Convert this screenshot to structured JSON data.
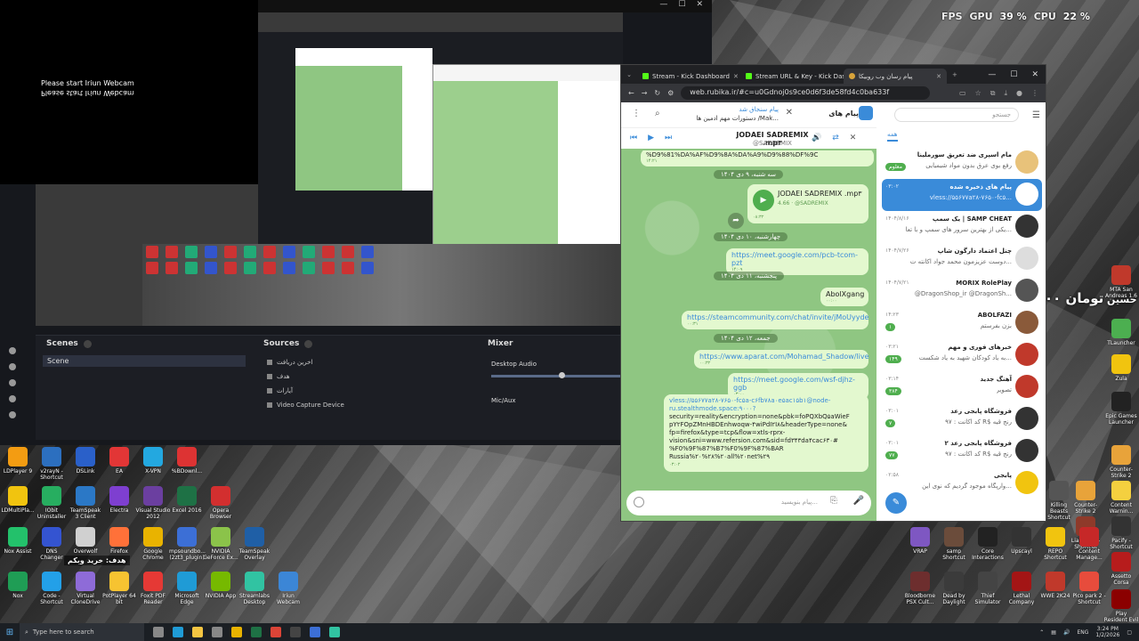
{
  "stats": {
    "fps_label": "FPS",
    "gpu_label": "GPU",
    "gpu_value": "39 %",
    "cpu_label": "CPU",
    "cpu_value": "22 %"
  },
  "webcam": {
    "message": "Please start Iriun Webcam",
    "message_mirror": "Please start Iriun Webcam"
  },
  "obs": {
    "scenes_title": "Scenes",
    "scene_name": "Scene",
    "sources_title": "Sources",
    "sources": [
      "اخرین دریافت",
      "هدف",
      "آیارات",
      "Video Capture Device"
    ],
    "mixer_title": "Mixer",
    "mixer_tracks": [
      "Desktop Audio",
      "Mic/Aux"
    ]
  },
  "desktop_icons_left": [
    {
      "label": "LDPlayer 9",
      "color": "#f39c12"
    },
    {
      "label": "v2rayN - Shortcut",
      "color": "#2c6fbf"
    },
    {
      "label": "DSLink",
      "color": "#2a60c9"
    },
    {
      "label": "EA",
      "color": "#e23636"
    },
    {
      "label": "X-VPN",
      "color": "#23a8e0"
    },
    {
      "label": "%BDownl...",
      "color": "#d33"
    },
    {
      "label": "LDMultiPla...",
      "color": "#f1c40f"
    },
    {
      "label": "IObit Uninstaller",
      "color": "#27ae60"
    },
    {
      "label": "TeamSpeak 3 Client",
      "color": "#2b78c6"
    },
    {
      "label": "Electra",
      "color": "#7e3fd0"
    },
    {
      "label": "Visual Studio 2012",
      "color": "#6b3fa0"
    },
    {
      "label": "Excel 2016",
      "color": "#1e7145"
    },
    {
      "label": "Opera Browser",
      "color": "#d32f2f"
    },
    {
      "label": "Nox Assist",
      "color": "#23c16b"
    },
    {
      "label": "DNS Changer",
      "color": "#3454d1"
    },
    {
      "label": "Overwolf",
      "color": "#d0d0d0"
    },
    {
      "label": "Firefox",
      "color": "#ff7139"
    },
    {
      "label": "Google Chrome",
      "color": "#e9b300"
    },
    {
      "label": "mpsoundbo... (2zt3_plugin)",
      "color": "#3c6fd6"
    },
    {
      "label": "NVIDIA GeForce Ex...",
      "color": "#8bc34a"
    },
    {
      "label": "TeamSpeak Overlay",
      "color": "#1f5fa6"
    },
    {
      "label": "Nox",
      "color": "#1f9d55"
    },
    {
      "label": "Code - Shortcut",
      "color": "#23a0e8"
    },
    {
      "label": "Virtual CloneDrive",
      "color": "#8e6bd8"
    },
    {
      "label": "PotPlayer 64 bit",
      "color": "#f7c331"
    },
    {
      "label": "Foxit PDF Reader",
      "color": "#e53935"
    },
    {
      "label": "Microsoft Edge",
      "color": "#1f9bd6"
    },
    {
      "label": "NVIDIA App",
      "color": "#76b900"
    },
    {
      "label": "Streamlabs Desktop",
      "color": "#31c3a2"
    },
    {
      "label": "Iriun Webcam",
      "color": "#3c86d6"
    }
  ],
  "desktop_icons_right": [
    {
      "label": "Epic Games Launcher",
      "color": "#222"
    },
    {
      "label": "Zula",
      "color": "#f1c40f"
    },
    {
      "label": "TLauncher",
      "color": "#4caf50"
    },
    {
      "label": "MTA San Andreas 1.6",
      "color": "#c0392b"
    },
    {
      "label": "Killing Beasts Shortcut",
      "color": "#555"
    },
    {
      "label": "Counter-Strike 2",
      "color": "#e8a33a"
    },
    {
      "label": "Counter-Strike 2",
      "color": "#e8a33a"
    },
    {
      "label": "Content Warnin...",
      "color": "#f4d03f"
    },
    {
      "label": "Liar's Bar - Shortcut",
      "color": "#8e3a2a"
    },
    {
      "label": "Pacify - Shortcut",
      "color": "#333"
    },
    {
      "label": "VRAP",
      "color": "#7e57c2"
    },
    {
      "label": "samp Shortcut",
      "color": "#6b4c3b"
    },
    {
      "label": "Core Interactions",
      "color": "#222"
    },
    {
      "label": "Upscayl",
      "color": "#333"
    },
    {
      "label": "REPO Shortcut",
      "color": "#f1c40f"
    },
    {
      "label": "Content Manage...",
      "color": "#c62828"
    },
    {
      "label": "Assetto Corsa",
      "color": "#b71c1c"
    },
    {
      "label": "Bloodborne PSX Cult...",
      "color": "#6d2e2e"
    },
    {
      "label": "Dead by Daylight",
      "color": "#3b3b3b"
    },
    {
      "label": "Thief Simulator",
      "color": "#444"
    },
    {
      "label": "Lethal Company",
      "color": "#a31515"
    },
    {
      "label": "WWE 2K24",
      "color": "#c0392b"
    },
    {
      "label": "Pico park 2 - Shortcut",
      "color": "#e74c3c"
    },
    {
      "label": "Play Resident Evil 4 Remake",
      "color": "#8b0000"
    }
  ],
  "overlay": {
    "big": "۵,۰۰۰ تومان",
    "name": "حسین",
    "target": "هدف: خرید وبکم"
  },
  "browser": {
    "tabs": [
      "Stream - Kick Dashboard",
      "Stream URL & Key - Kick Das...",
      "پیام رسان وب روبیکا"
    ],
    "url": "web.rubika.ir/#c=u0Gdnoj0s9ce0d6f3de58fd4c0ba633f",
    "window_controls": [
      "—",
      "☐",
      "✕"
    ]
  },
  "chat": {
    "title": "پیام های",
    "pinned_title": "پیام سنجاق شد",
    "pinned_text": "دستورات مهم ادمین ها /Mak...",
    "player_title": "JODAEI SADREMIX .mp۳",
    "player_performer": "@SADREMIX",
    "top_fragment": "%D9%81%DA%AF%D9%8A%DA%A9%D9%88%DF%9C",
    "top_time": "۱۴:۲۱",
    "date1": "سه شنبه، ۹ دی ۱۴۰۴",
    "audio_title": "JODAEI SADREMIX .mp۳",
    "audio_meta": "4.66 · @SADREMIX",
    "audio_time": "۰۸:۳۲",
    "date2": "چهارشنبه، ۱۰ دی ۱۴۰۴",
    "link1": "https://meet.google.com/pcb-tcom-pzt",
    "link1_time": "۱۴:۰۹",
    "date3": "پنجشنبه، ۱۱ دی ۱۴۰۴",
    "msg_abol": "AbolXgang",
    "msg_abol_time": "۰۰:۰۰",
    "link2": "https://steamcommunity.com/chat/invite/jMoUyyde",
    "link2_time": "۰۰:۳۱",
    "date4": "جمعه، ۱۲ دی ۱۴۰۴",
    "link3": "https://www.aparat.com/Mohamad_Shadow/live",
    "link3_time": "۰۰:۳۲",
    "link4": "https://meet.google.com/wsf-djhz-ggb",
    "link4_time": "۰۳:۰۰",
    "vless_lines": [
      "vless://۵۵۶۷۷a۲۸-۷۶۵۰-fc۵a-c۶fb۷۸a۰e۵ac۱۵b۱@node-",
      "ru.stealthmode.space:۹۰۰۰?",
      "security=reality&encryption=none&pbk=foPQXbQ۵aWieF",
      "pY۲FOpZMnHBDEnhwoqw-۴wiPdI۲I۸&headerType=none&",
      "fp=firefox&type=tcp&flow=xtls-rprx-",
      "vision&sni=www.refersion.com&sid=fd۳۴۳da۴cac۶۳۰#",
      "%F0%9F%87%B7%F0%9F%87%BAR",
      "Russia%۲۰%۲۸%۲۰all%۲۰net%۲۹"
    ],
    "vless_time": "۰۳:۰۲",
    "composer_placeholder": "پیام بنویسید..."
  },
  "list": {
    "search_placeholder": "جستجو",
    "tab": "همه",
    "items": [
      {
        "name": "مام اسپری ضد تعریق سورملینا",
        "preview": "رفع بوی عرق بدون مواد شیمیایی",
        "time": "",
        "badge": "معلوم",
        "color": "#e8c27a"
      },
      {
        "name": "پیام های ذخیره شده",
        "preview": "vless://۵۵۶۷۷a۲۸-۷۶۵۰-fc۵...",
        "time": "۰۳:۰۲",
        "badge": "",
        "color": "#fff",
        "selected": true
      },
      {
        "name": "یک سمپ | SAMP CHEAT",
        "preview": "یکی از بهترین سرور های سمپ و با تعا...",
        "time": "۱۴۰۴/۸/۱۶",
        "badge": "",
        "color": "#333"
      },
      {
        "name": "چنل اعتماد دارگون شاپ",
        "preview": "دوست عزیزمون محمد جواد اکانته ت...",
        "time": "۱۴۰۴/۷/۲۶",
        "badge": "",
        "color": "#ddd"
      },
      {
        "name": "MORIX RolePlay",
        "preview": "@DragonShop_ir @DragonSh...",
        "time": "۱۴۰۴/۷/۲۱",
        "badge": "",
        "color": "#555"
      },
      {
        "name": "ABOLFAZI",
        "preview": "بزن بفرستم",
        "time": "۱۴:۲۳",
        "badge": "۱",
        "color": "#8a5a3a"
      },
      {
        "name": "خبرهای فوری و مهم",
        "preview": "به یاد کودکان شهید به یاد شکست...",
        "time": "۰۳:۲۱",
        "badge": "۱۴۹",
        "color": "#c0392b"
      },
      {
        "name": "آهنگ جدید",
        "preview": "تصویر",
        "time": "۰۳:۱۴",
        "badge": "۳۸۴",
        "color": "#c0392b"
      },
      {
        "name": "فروشگاه پابجی رعد",
        "preview": "کد اکانت : ۹۷ R$ رنج قیه",
        "time": "۰۳:۰۱",
        "badge": "۷",
        "color": "#333"
      },
      {
        "name": "فروشگاه پابجی رعد ۲",
        "preview": "کد اکانت : ۹۷ R$ رنج قیه",
        "time": "۰۳:۰۱",
        "badge": "۷۷",
        "color": "#333"
      },
      {
        "name": "پابجی",
        "preview": "وارپگاه موجود گردیم که نوی این...",
        "time": "۰۲:۵۸",
        "badge": "",
        "color": "#f1c40f"
      }
    ]
  },
  "taskbar": {
    "search": "Type here to search",
    "time": "3:24 PM",
    "date": "1/2/2026",
    "lang": "ENG"
  }
}
